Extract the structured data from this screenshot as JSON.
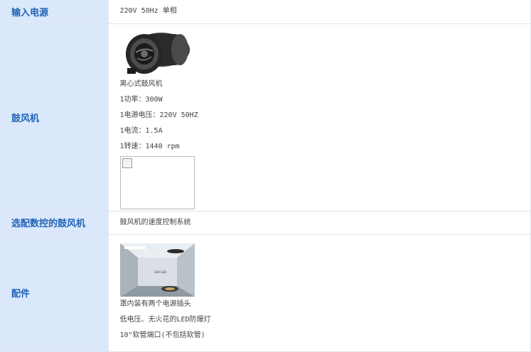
{
  "rows": [
    {
      "label": "输入电源",
      "lines": [
        "220V 50Hz 单相"
      ]
    },
    {
      "label": "鼓风机",
      "lines": [
        "离心式鼓风机",
        "1功率：300W",
        "1电源电压：220V 50HZ",
        "1电流：1.5A",
        "1转速：1440 rpm"
      ]
    },
    {
      "label": "选配数控的鼓风机",
      "lines": [
        "鼓风机的速度控制系统"
      ]
    },
    {
      "label": "配件",
      "lines": [
        "罩内装有两个电源插头",
        "低电压、无火花的LED防爆灯",
        "10\"软管端口(不包括软管)"
      ]
    }
  ],
  "images": {
    "fan": "blower-fan-photo",
    "broken": "broken-image-placeholder",
    "room": "hood-interior-photo",
    "room_sign": "24V LED"
  }
}
